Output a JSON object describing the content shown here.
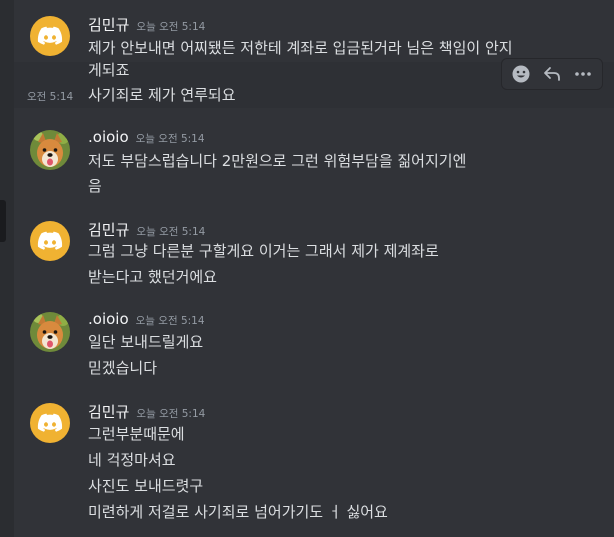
{
  "messages": [
    {
      "author": "김민규",
      "time": "오늘 오전 5:14",
      "lines": [
        "제가 안보내면 어찌됐든 저한테 계좌로 입금된거라 님은 책임이 안지",
        "게되죠"
      ],
      "followups": [
        {
          "time": "오전 5:14",
          "text": "사기죄로 제가 연루되요"
        }
      ]
    },
    {
      "author": ".oioio",
      "time": "오늘 오전 5:14",
      "lines": [
        "저도 부담스럽습니다 2만원으로 그런 위험부담을 짊어지기엔",
        "음"
      ]
    },
    {
      "author": "김민규",
      "time": "오늘 오전 5:14",
      "lines": [
        "그럼 그냥 다른분 구할게요 이거는 그래서 제가 제계좌로",
        "받는다고 했던거에요"
      ]
    },
    {
      "author": ".oioio",
      "time": "오늘 오전 5:14",
      "lines": [
        "일단 보내드릴게요",
        "믿겠습니다"
      ]
    },
    {
      "author": "김민규",
      "time": "오늘 오전 5:14",
      "lines": [
        "그런부분때문에",
        "네 걱정마셔요",
        "사진도 보내드렷구",
        "미련하게 저걸로 사기죄로 넘어가기도 ㅓ 싫어요"
      ]
    }
  ],
  "toolbar": {
    "icons": [
      "emoji-reaction-icon",
      "reply-icon",
      "more-options-icon"
    ]
  },
  "colors": {
    "background": "#313338",
    "discord_avatar": "#f0b232",
    "username": "#f2f3f5",
    "timestamp": "#949ba4",
    "text": "#dbdee1"
  }
}
